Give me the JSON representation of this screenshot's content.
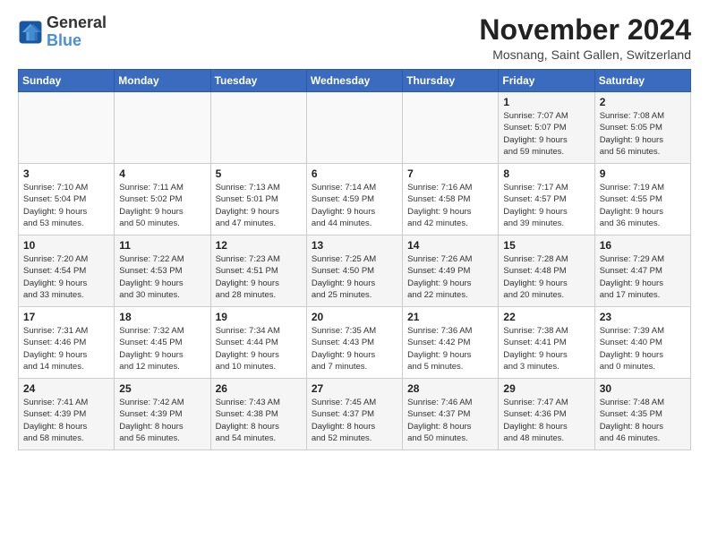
{
  "logo": {
    "text_general": "General",
    "text_blue": "Blue"
  },
  "header": {
    "title": "November 2024",
    "subtitle": "Mosnang, Saint Gallen, Switzerland"
  },
  "weekdays": [
    "Sunday",
    "Monday",
    "Tuesday",
    "Wednesday",
    "Thursday",
    "Friday",
    "Saturday"
  ],
  "weeks": [
    [
      {
        "day": "",
        "info": ""
      },
      {
        "day": "",
        "info": ""
      },
      {
        "day": "",
        "info": ""
      },
      {
        "day": "",
        "info": ""
      },
      {
        "day": "",
        "info": ""
      },
      {
        "day": "1",
        "info": "Sunrise: 7:07 AM\nSunset: 5:07 PM\nDaylight: 9 hours\nand 59 minutes."
      },
      {
        "day": "2",
        "info": "Sunrise: 7:08 AM\nSunset: 5:05 PM\nDaylight: 9 hours\nand 56 minutes."
      }
    ],
    [
      {
        "day": "3",
        "info": "Sunrise: 7:10 AM\nSunset: 5:04 PM\nDaylight: 9 hours\nand 53 minutes."
      },
      {
        "day": "4",
        "info": "Sunrise: 7:11 AM\nSunset: 5:02 PM\nDaylight: 9 hours\nand 50 minutes."
      },
      {
        "day": "5",
        "info": "Sunrise: 7:13 AM\nSunset: 5:01 PM\nDaylight: 9 hours\nand 47 minutes."
      },
      {
        "day": "6",
        "info": "Sunrise: 7:14 AM\nSunset: 4:59 PM\nDaylight: 9 hours\nand 44 minutes."
      },
      {
        "day": "7",
        "info": "Sunrise: 7:16 AM\nSunset: 4:58 PM\nDaylight: 9 hours\nand 42 minutes."
      },
      {
        "day": "8",
        "info": "Sunrise: 7:17 AM\nSunset: 4:57 PM\nDaylight: 9 hours\nand 39 minutes."
      },
      {
        "day": "9",
        "info": "Sunrise: 7:19 AM\nSunset: 4:55 PM\nDaylight: 9 hours\nand 36 minutes."
      }
    ],
    [
      {
        "day": "10",
        "info": "Sunrise: 7:20 AM\nSunset: 4:54 PM\nDaylight: 9 hours\nand 33 minutes."
      },
      {
        "day": "11",
        "info": "Sunrise: 7:22 AM\nSunset: 4:53 PM\nDaylight: 9 hours\nand 30 minutes."
      },
      {
        "day": "12",
        "info": "Sunrise: 7:23 AM\nSunset: 4:51 PM\nDaylight: 9 hours\nand 28 minutes."
      },
      {
        "day": "13",
        "info": "Sunrise: 7:25 AM\nSunset: 4:50 PM\nDaylight: 9 hours\nand 25 minutes."
      },
      {
        "day": "14",
        "info": "Sunrise: 7:26 AM\nSunset: 4:49 PM\nDaylight: 9 hours\nand 22 minutes."
      },
      {
        "day": "15",
        "info": "Sunrise: 7:28 AM\nSunset: 4:48 PM\nDaylight: 9 hours\nand 20 minutes."
      },
      {
        "day": "16",
        "info": "Sunrise: 7:29 AM\nSunset: 4:47 PM\nDaylight: 9 hours\nand 17 minutes."
      }
    ],
    [
      {
        "day": "17",
        "info": "Sunrise: 7:31 AM\nSunset: 4:46 PM\nDaylight: 9 hours\nand 14 minutes."
      },
      {
        "day": "18",
        "info": "Sunrise: 7:32 AM\nSunset: 4:45 PM\nDaylight: 9 hours\nand 12 minutes."
      },
      {
        "day": "19",
        "info": "Sunrise: 7:34 AM\nSunset: 4:44 PM\nDaylight: 9 hours\nand 10 minutes."
      },
      {
        "day": "20",
        "info": "Sunrise: 7:35 AM\nSunset: 4:43 PM\nDaylight: 9 hours\nand 7 minutes."
      },
      {
        "day": "21",
        "info": "Sunrise: 7:36 AM\nSunset: 4:42 PM\nDaylight: 9 hours\nand 5 minutes."
      },
      {
        "day": "22",
        "info": "Sunrise: 7:38 AM\nSunset: 4:41 PM\nDaylight: 9 hours\nand 3 minutes."
      },
      {
        "day": "23",
        "info": "Sunrise: 7:39 AM\nSunset: 4:40 PM\nDaylight: 9 hours\nand 0 minutes."
      }
    ],
    [
      {
        "day": "24",
        "info": "Sunrise: 7:41 AM\nSunset: 4:39 PM\nDaylight: 8 hours\nand 58 minutes."
      },
      {
        "day": "25",
        "info": "Sunrise: 7:42 AM\nSunset: 4:39 PM\nDaylight: 8 hours\nand 56 minutes."
      },
      {
        "day": "26",
        "info": "Sunrise: 7:43 AM\nSunset: 4:38 PM\nDaylight: 8 hours\nand 54 minutes."
      },
      {
        "day": "27",
        "info": "Sunrise: 7:45 AM\nSunset: 4:37 PM\nDaylight: 8 hours\nand 52 minutes."
      },
      {
        "day": "28",
        "info": "Sunrise: 7:46 AM\nSunset: 4:37 PM\nDaylight: 8 hours\nand 50 minutes."
      },
      {
        "day": "29",
        "info": "Sunrise: 7:47 AM\nSunset: 4:36 PM\nDaylight: 8 hours\nand 48 minutes."
      },
      {
        "day": "30",
        "info": "Sunrise: 7:48 AM\nSunset: 4:35 PM\nDaylight: 8 hours\nand 46 minutes."
      }
    ]
  ]
}
